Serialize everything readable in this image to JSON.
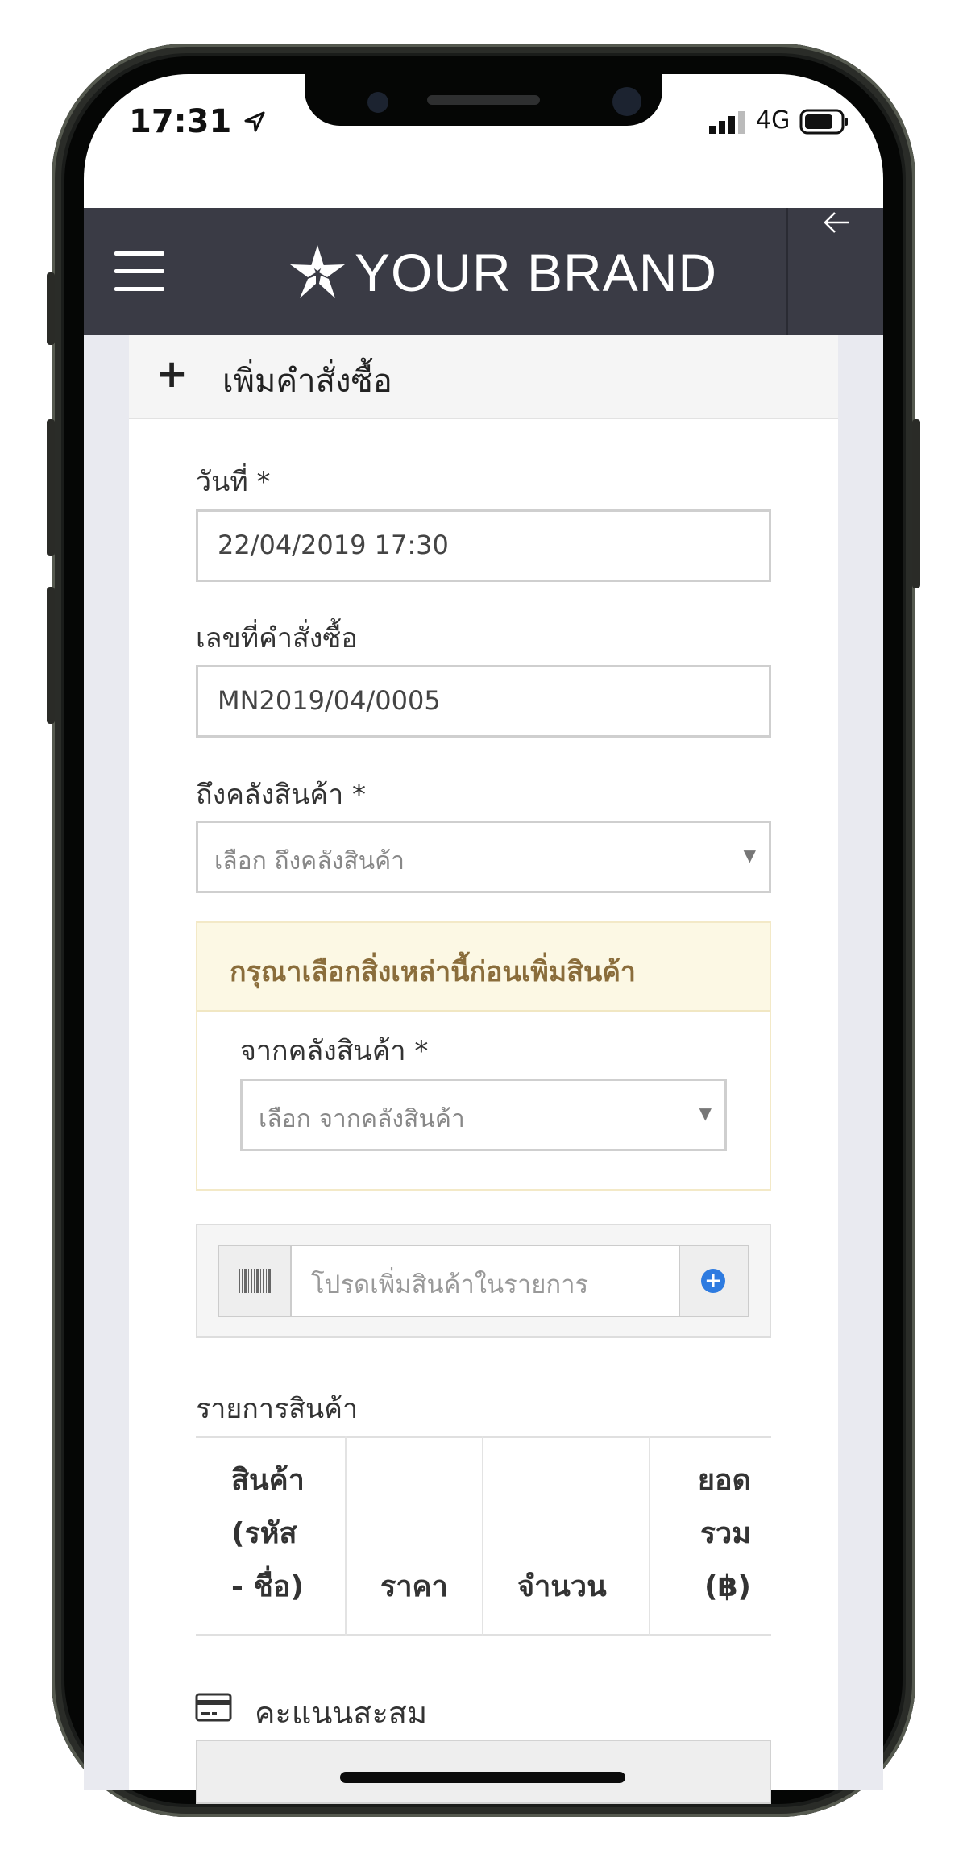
{
  "status_bar": {
    "time": "17:31",
    "network": "4G"
  },
  "header": {
    "brand": "YOUR BRAND"
  },
  "card": {
    "title": "เพิ่มคำสั่งซื้อ"
  },
  "form": {
    "date_label": "วันที่ *",
    "date_value": "22/04/2019 17:30",
    "order_no_label": "เลขที่คำสั่งซื้อ",
    "order_no_value": "MN2019/04/0005",
    "to_warehouse_label": "ถึงคลังสินค้า *",
    "to_warehouse_placeholder": "เลือก ถึงคลังสินค้า",
    "warning": {
      "message": "กรุณาเลือกสิ่งเหล่านี้ก่อนเพิ่มสินค้า",
      "from_warehouse_label": "จากคลังสินค้า *",
      "from_warehouse_placeholder": "เลือก จากคลังสินค้า"
    },
    "barcode_placeholder": "โปรดเพิ่มสินค้าในรายการ"
  },
  "items_table": {
    "title": "รายการสินค้า",
    "columns": [
      "สินค้า (รหัส - ชื่อ)",
      "ราคา",
      "จำนวน",
      "ยอดรวม (฿)"
    ],
    "col1_lines": [
      "สินค้า",
      "(รหัส",
      "- ชื่อ)"
    ],
    "col4_lines": [
      "ยอด",
      "รวม",
      "(฿)"
    ]
  },
  "points": {
    "title": "คะแนนสะสม"
  }
}
